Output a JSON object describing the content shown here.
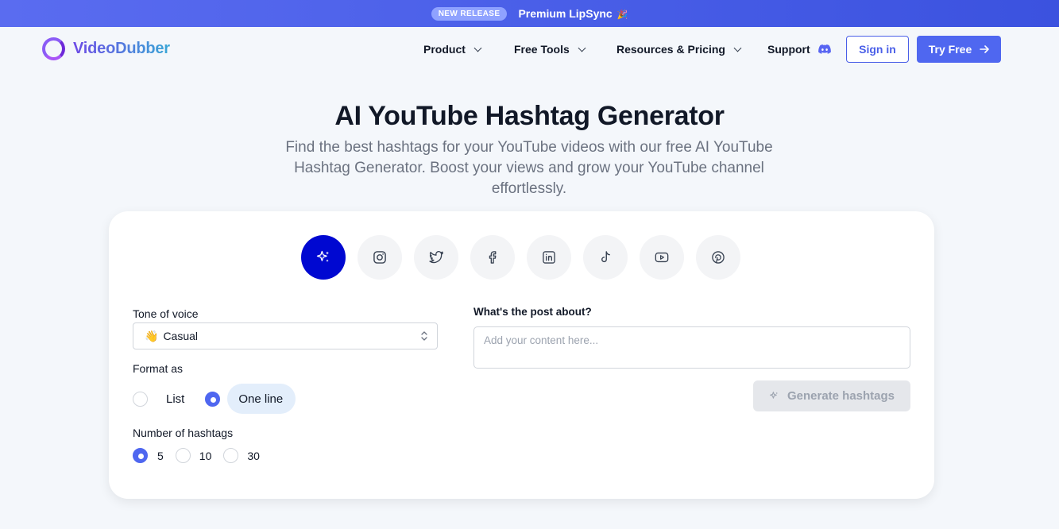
{
  "banner": {
    "badge": "NEW RELEASE",
    "text": "Premium LipSync",
    "emoji": "🎉"
  },
  "nav": {
    "logo_text": "VideoDubber",
    "items": [
      {
        "label": "Product",
        "icon": "chevron-down-icon"
      },
      {
        "label": "Free Tools",
        "icon": "chevron-down-icon"
      },
      {
        "label": "Resources & Pricing",
        "icon": "chevron-down-icon"
      },
      {
        "label": "Support",
        "icon": "discord-icon"
      }
    ],
    "signin": "Sign in",
    "try_free": "Try Free"
  },
  "hero": {
    "title": "AI YouTube Hashtag Generator",
    "subtitle": "Find the best hashtags for your YouTube videos with our free AI YouTube Hashtag Generator. Boost your views and grow your YouTube channel effortlessly."
  },
  "platforms": [
    "sparkles-icon",
    "instagram-icon",
    "twitter-icon",
    "facebook-icon",
    "linkedin-icon",
    "tiktok-icon",
    "youtube-icon",
    "pinterest-icon"
  ],
  "form": {
    "tone_label": "Tone of voice",
    "tone_value": "Casual",
    "tone_emoji": "👋",
    "format_label": "Format as",
    "format_options": [
      "List",
      "One line"
    ],
    "format_selected": "One line",
    "count_label": "Number of hashtags",
    "count_options": [
      "5",
      "10",
      "30"
    ],
    "count_selected": "5",
    "post_label": "What's the post about?",
    "post_placeholder": "Add your content here...",
    "generate": "Generate hashtags"
  },
  "colors": {
    "accent": "#4f67f0",
    "active_platform": "#0008d1",
    "banner": "#4a5fe8"
  }
}
